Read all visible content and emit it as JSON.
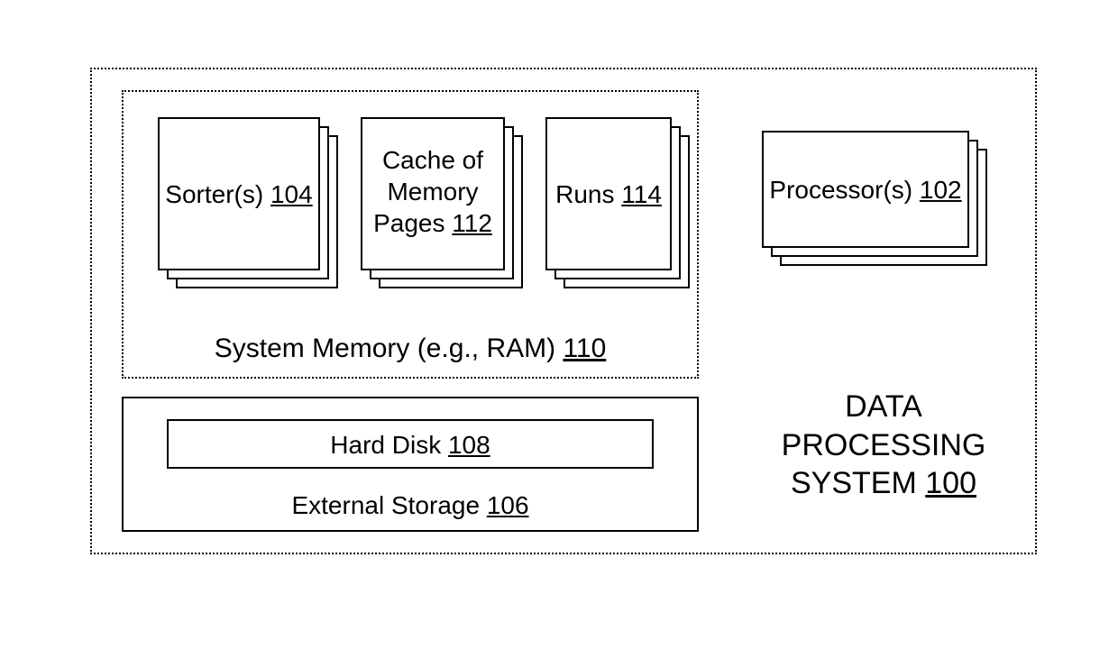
{
  "system": {
    "title_line1": "DATA",
    "title_line2": "PROCESSING",
    "title_line3_prefix": "SYSTEM ",
    "title_line3_ref": "100"
  },
  "processor": {
    "label_prefix": "Processor(s) ",
    "ref": "102"
  },
  "memory": {
    "label_prefix": "System Memory (e.g., RAM) ",
    "ref": "110",
    "sorter": {
      "label_prefix": "Sorter(s) ",
      "ref": "104"
    },
    "cache": {
      "line1": "Cache of",
      "line2": "Memory",
      "line3_prefix": "Pages ",
      "ref": "112"
    },
    "runs": {
      "label_prefix": "Runs ",
      "ref": "114"
    }
  },
  "storage": {
    "label_prefix": "External Storage ",
    "ref": "106",
    "hard_disk": {
      "label_prefix": "Hard Disk ",
      "ref": "108"
    }
  }
}
